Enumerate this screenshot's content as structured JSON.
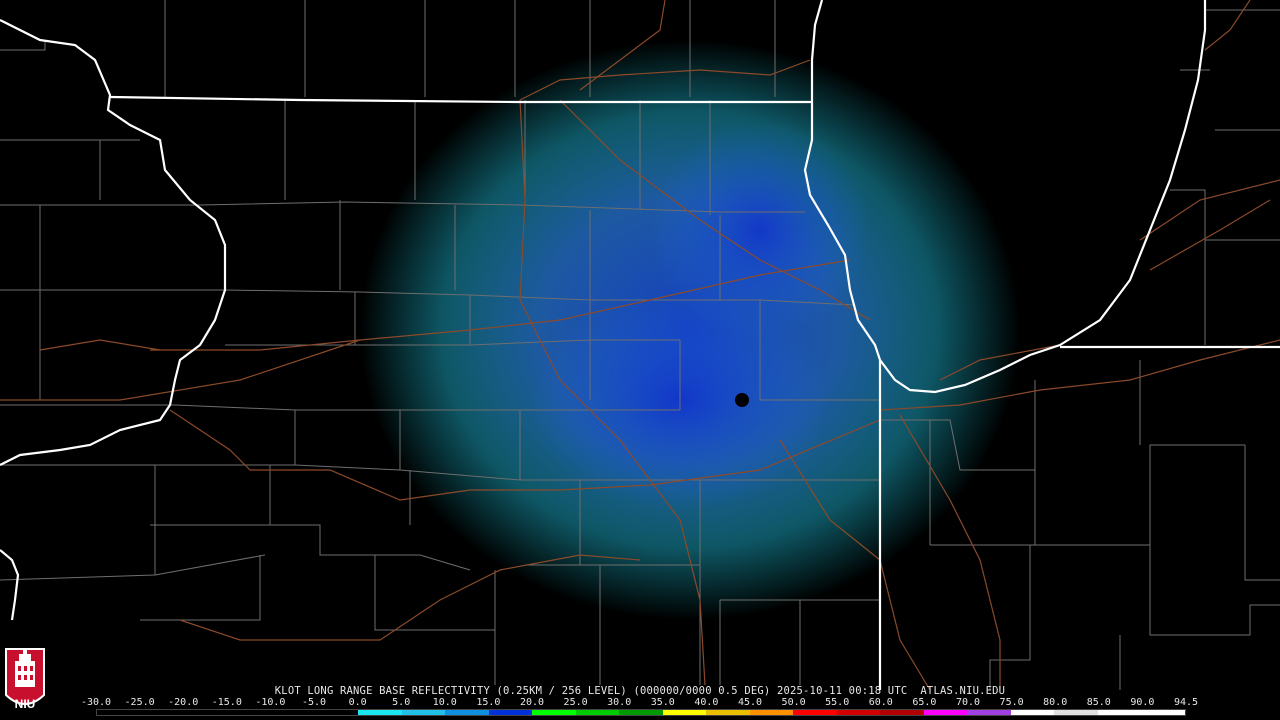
{
  "caption": "KLOT LONG RANGE BASE REFLECTIVITY (0.25KM / 256 LEVEL) (000000/0000 0.5 DEG) 2025-10-11 00:18 UTC  ATLAS.NIU.EDU",
  "logo_text": "NIU",
  "scale": {
    "labels": [
      "-30.0",
      "-25.0",
      "-20.0",
      "-15.0",
      "-10.0",
      "-5.0",
      "0.0",
      "5.0",
      "10.0",
      "15.0",
      "20.0",
      "25.0",
      "30.0",
      "35.0",
      "40.0",
      "45.0",
      "50.0",
      "55.0",
      "60.0",
      "65.0",
      "70.0",
      "75.0",
      "80.0",
      "85.0",
      "90.0",
      "94.5"
    ],
    "colors": [
      "#000000",
      "#000000",
      "#000000",
      "#000000",
      "#000000",
      "#000000",
      "#1ae6f0",
      "#20c0e8",
      "#0f8fe0",
      "#0030d8",
      "#00ff00",
      "#00cc00",
      "#009900",
      "#ffff00",
      "#e8c000",
      "#ff9000",
      "#ff0000",
      "#d00000",
      "#b00000",
      "#ff00ff",
      "#a040e0",
      "#ffffff",
      "#e0e0e0",
      "#ffffff",
      "#ffffff"
    ]
  },
  "map": {
    "radar_site": "KLOT",
    "colors": {
      "state_border": "#ffffff",
      "county_line": "#6e6e6e",
      "highway": "#8b4a2a",
      "echo_light": "#18d0e0",
      "echo_mid": "#2090e8",
      "echo_strong": "#1040d8",
      "echo_green": "#20c040"
    }
  }
}
